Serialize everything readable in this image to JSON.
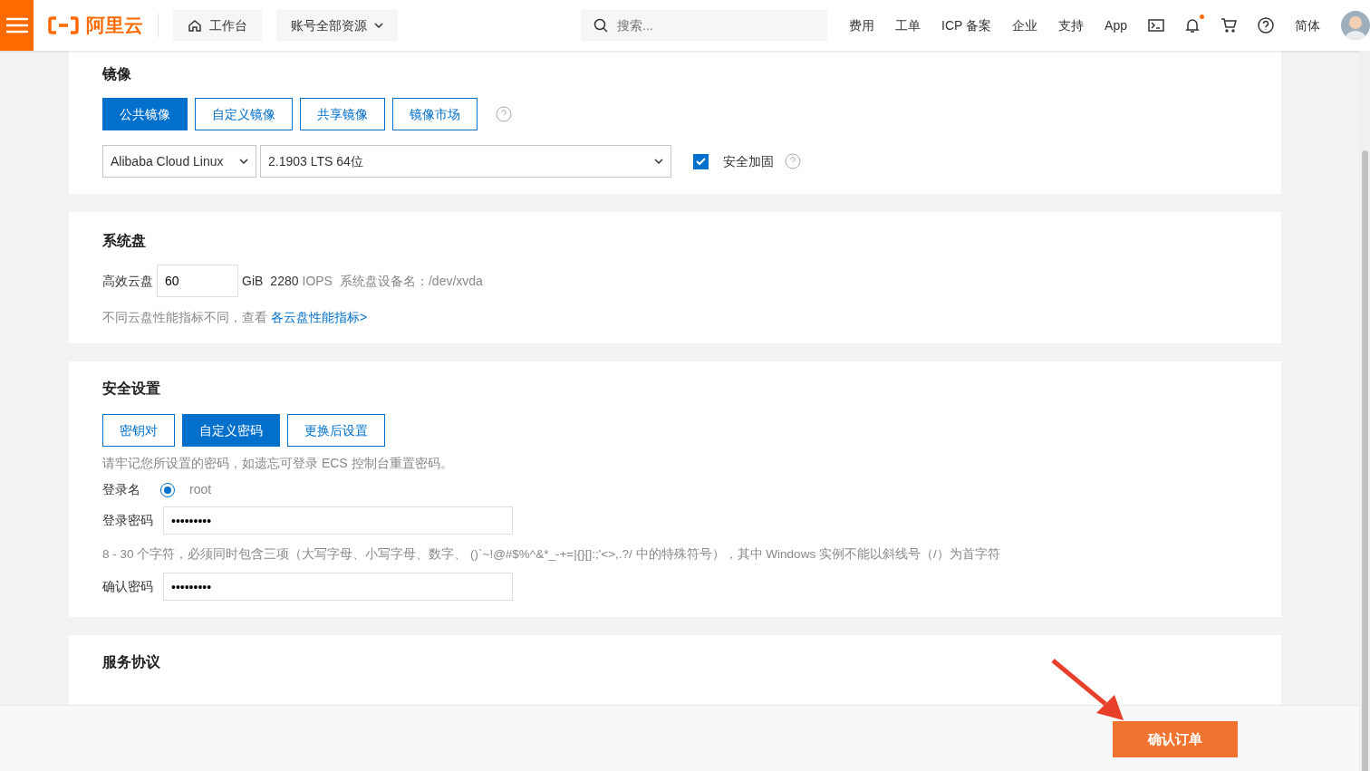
{
  "topbar": {
    "logo": "阿里云",
    "workbench": "工作台",
    "resources": "账号全部资源",
    "search_placeholder": "搜索...",
    "links": [
      "费用",
      "工单",
      "ICP 备案",
      "企业",
      "支持",
      "App"
    ],
    "notification_dot": true,
    "language": "简体"
  },
  "image_section": {
    "title": "镜像",
    "tabs": [
      {
        "label": "公共镜像",
        "selected": true
      },
      {
        "label": "自定义镜像",
        "selected": false
      },
      {
        "label": "共享镜像",
        "selected": false
      },
      {
        "label": "镜像市场",
        "selected": false
      }
    ],
    "os": "Alibaba Cloud Linux",
    "version": "2.1903 LTS 64位",
    "hardening": {
      "label": "安全加固",
      "checked": true
    }
  },
  "disk_section": {
    "title": "系统盘",
    "type": "高效云盘",
    "size": "60",
    "unit": "GiB",
    "iops_value": "2280",
    "iops_unit": "IOPS",
    "device_label": "系统盘设备名：",
    "device": "/dev/xvda",
    "hint": "不同云盘性能指标不同，查看",
    "hint_link": "各云盘性能指标>"
  },
  "security_section": {
    "title": "安全设置",
    "tabs": [
      {
        "label": "密钥对",
        "selected": false
      },
      {
        "label": "自定义密码",
        "selected": true
      },
      {
        "label": "更换后设置",
        "selected": false
      }
    ],
    "notice": "请牢记您所设置的密码，如遗忘可登录 ECS 控制台重置密码。",
    "login_label": "登录名",
    "login_options": [
      {
        "label": "root",
        "selected": true
      }
    ],
    "password_label": "登录密码",
    "password_value": "•••••••••",
    "rule": "8 - 30 个字符，必须同时包含三项（大写字母、小写字母、数字、 ()`~!@#$%^&*_-+=|{}[]:;'<>,.?/ 中的特殊符号），其中 Windows 实例不能以斜线号（/）为首字符",
    "confirm_label": "确认密码",
    "confirm_value": "•••••••••"
  },
  "agreement_section": {
    "title": "服务协议"
  },
  "footer": {
    "confirm_button": "确认订单"
  }
}
